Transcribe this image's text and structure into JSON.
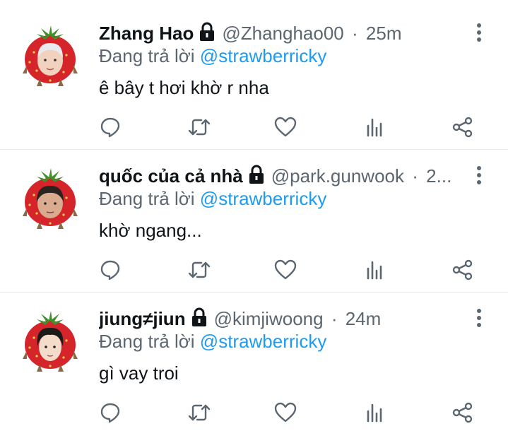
{
  "colors": {
    "accent": "#1d9bf0",
    "secondary_text": "#5b6670",
    "icon": "#5b6670",
    "strawberry": "#d6242b"
  },
  "icons": {
    "lock": "lock-icon",
    "more": "more-vertical-icon",
    "reply": "reply-icon",
    "retweet": "retweet-icon",
    "like": "heart-icon",
    "views": "bar-chart-icon",
    "share": "share-icon"
  },
  "tweets": [
    {
      "name": "Zhang Hao",
      "handle": "@Zhanghao00",
      "sep": "·",
      "time": "25m",
      "reply_prefix": "Đang trả lời",
      "reply_to": "@strawberricky",
      "text": "ê bây t hơi khờ r nha"
    },
    {
      "name": "quốc của cả nhà",
      "handle": "@park.gunwook",
      "sep": "·",
      "time": "2...",
      "reply_prefix": "Đang trả lời",
      "reply_to": "@strawberricky",
      "text": "khờ ngang..."
    },
    {
      "name": "jiung≠jiun",
      "handle": "@kimjiwoong",
      "sep": "·",
      "time": "24m",
      "reply_prefix": "Đang trả lời",
      "reply_to": "@strawberricky",
      "text": "gì vay troi"
    }
  ]
}
